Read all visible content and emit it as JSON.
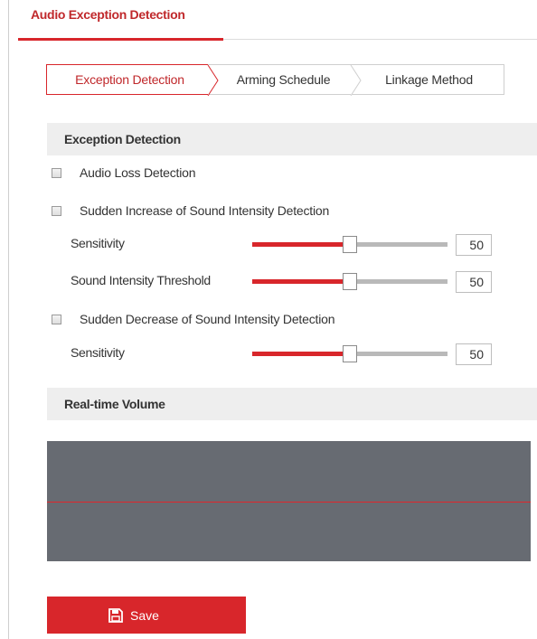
{
  "page_tab": {
    "label": "Audio Exception Detection"
  },
  "steps": [
    {
      "label": "Exception Detection",
      "active": true
    },
    {
      "label": "Arming Schedule",
      "active": false
    },
    {
      "label": "Linkage Method",
      "active": false
    }
  ],
  "exception_section": {
    "title": "Exception Detection"
  },
  "audio_loss": {
    "label": "Audio Loss Detection",
    "checked": false
  },
  "sudden_increase": {
    "label": "Sudden Increase of Sound Intensity Detection",
    "checked": false,
    "sensitivity": {
      "label": "Sensitivity",
      "value": "50",
      "level": 0.5
    },
    "threshold": {
      "label": "Sound Intensity Threshold",
      "value": "50",
      "level": 0.5
    }
  },
  "sudden_decrease": {
    "label": "Sudden Decrease of Sound Intensity Detection",
    "checked": false,
    "sensitivity": {
      "label": "Sensitivity",
      "value": "50",
      "level": 0.5
    }
  },
  "realtime_section": {
    "title": "Real-time Volume",
    "threshold_level": 0.5
  },
  "save_button": {
    "label": "Save",
    "icon": "save-icon"
  },
  "colors": {
    "accent": "#d8262b",
    "panel": "#676b72",
    "header_bg": "#eeeeee"
  }
}
